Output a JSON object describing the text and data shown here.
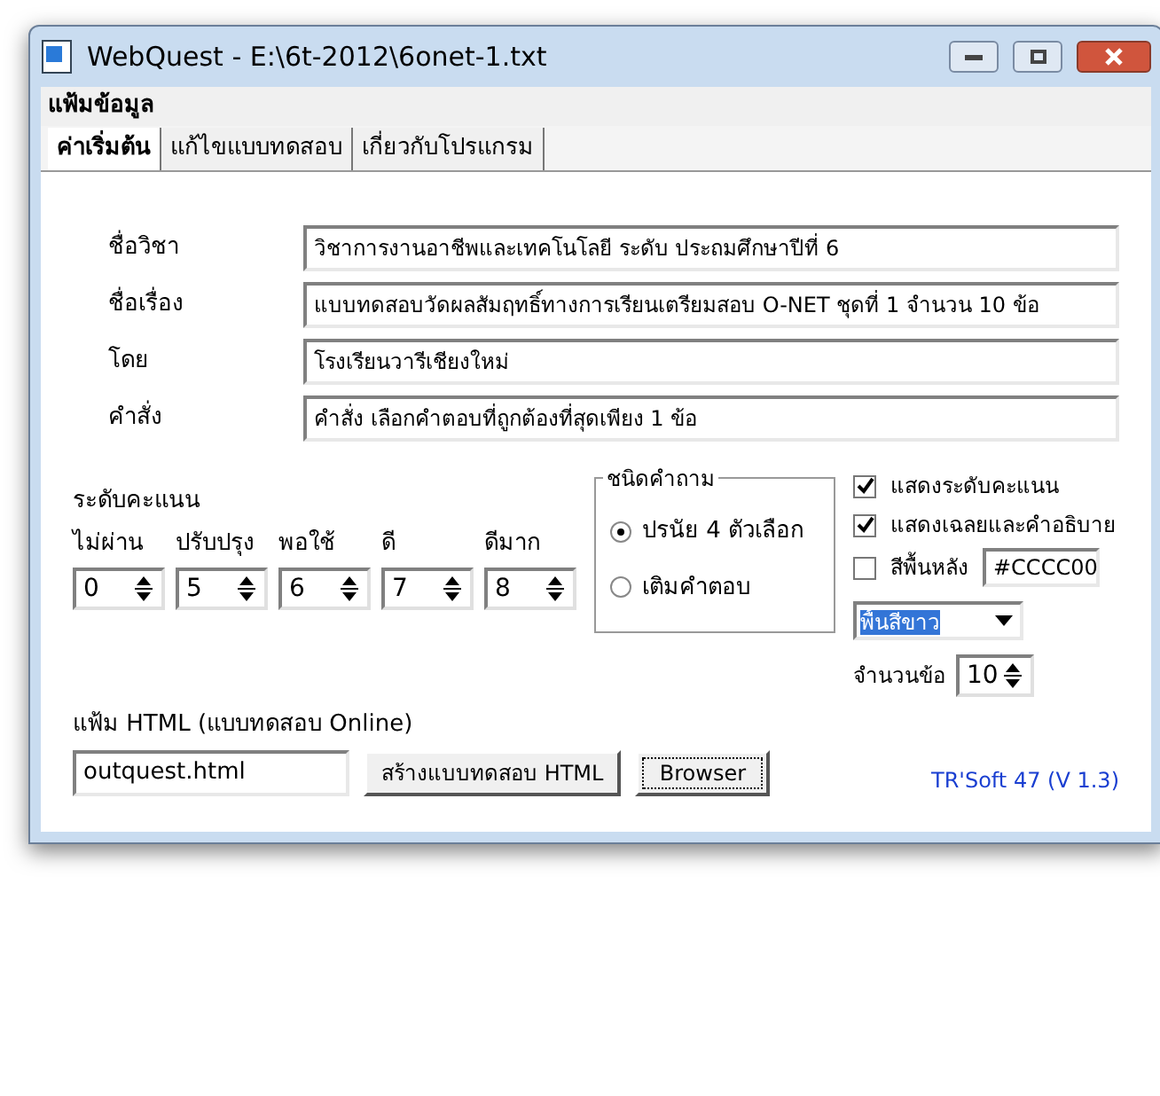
{
  "window": {
    "title": "WebQuest - E:\\6t-2012\\6onet-1.txt"
  },
  "menu": [
    "แฟ้มข้อมูล"
  ],
  "tabs": [
    {
      "label": "ค่าเริ่มต้น",
      "selected": true
    },
    {
      "label": "แก้ไขแบบทดสอบ",
      "selected": false
    },
    {
      "label": "เกี่ยวกับโปรแกรม",
      "selected": false
    }
  ],
  "fields": [
    {
      "label": "ชื่อวิชา",
      "value": "วิชาการงานอาชีพและเทคโนโลยี  ระดับ ประถมศึกษาปีที่ 6"
    },
    {
      "label": "ชื่อเรื่อง",
      "value": "แบบทดสอบวัดผลสัมฤทธิ์ทางการเรียนเตรียมสอบ O-NET ชุดที่ 1 จำนวน 10 ข้อ"
    },
    {
      "label": "โดย",
      "value": "โรงเรียนวารีเชียงใหม่"
    },
    {
      "label": "คำสั่ง",
      "value": "คำสั่ง เลือกคำตอบที่ถูกต้องที่สุดเพียง  1 ข้อ"
    }
  ],
  "score_levels": {
    "title": "ระดับคะแนน",
    "items": [
      {
        "label": "ไม่ผ่าน",
        "value": "0"
      },
      {
        "label": "ปรับปรุง",
        "value": "5"
      },
      {
        "label": "พอใช้",
        "value": "6"
      },
      {
        "label": "ดี",
        "value": "7"
      },
      {
        "label": "ดีมาก",
        "value": "8"
      }
    ]
  },
  "question_type": {
    "title": "ชนิดคำถาม",
    "options": [
      {
        "label": "ปรนัย 4 ตัวเลือก",
        "selected": true
      },
      {
        "label": "เติมคำตอบ",
        "selected": false
      }
    ]
  },
  "options": [
    {
      "label": "แสดงระดับคะแนน",
      "checked": true
    },
    {
      "label": "แสดงเฉลยและคำอธิบาย",
      "checked": true
    },
    {
      "label": "สีพื้นหลัง",
      "checked": false,
      "value": "#CCCC00"
    }
  ],
  "background_select": {
    "value": "พื้นสีขาว"
  },
  "question_count": {
    "label": "จำนวนข้อ",
    "value": "10"
  },
  "html_file": {
    "label": "แฟ้ม HTML (แบบทดสอบ Online)",
    "value": "outquest.html"
  },
  "buttons": [
    "สร้างแบบทดสอบ HTML",
    "Browser"
  ],
  "credit": "TR'Soft 47 (V 1.3)"
}
